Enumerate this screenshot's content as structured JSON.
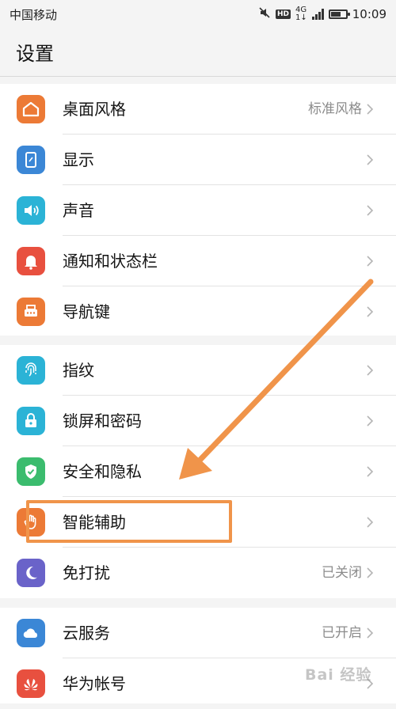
{
  "status_bar": {
    "carrier": "中国移动",
    "network_top": "4G",
    "network_bottom": "1↓",
    "hd": "HD",
    "time": "10:09"
  },
  "header": {
    "title": "设置"
  },
  "groups": [
    {
      "items": [
        {
          "label": "桌面风格",
          "value": "标准风格",
          "icon": "home-icon",
          "color": "#ec7a36"
        },
        {
          "label": "显示",
          "value": "",
          "icon": "display-icon",
          "color": "#3b87d6"
        },
        {
          "label": "声音",
          "value": "",
          "icon": "speaker-icon",
          "color": "#2bb3d6"
        },
        {
          "label": "通知和状态栏",
          "value": "",
          "icon": "bell-icon",
          "color": "#e8503f"
        },
        {
          "label": "导航键",
          "value": "",
          "icon": "navigation-keys-icon",
          "color": "#ec7a36"
        }
      ]
    },
    {
      "items": [
        {
          "label": "指纹",
          "value": "",
          "icon": "fingerprint-icon",
          "color": "#2bb3d6"
        },
        {
          "label": "锁屏和密码",
          "value": "",
          "icon": "lock-icon",
          "color": "#2bb3d6"
        },
        {
          "label": "安全和隐私",
          "value": "",
          "icon": "shield-icon",
          "color": "#3bbc6e"
        },
        {
          "label": "智能辅助",
          "value": "",
          "icon": "hand-icon",
          "color": "#ec7a36"
        },
        {
          "label": "免打扰",
          "value": "已关闭",
          "icon": "moon-icon",
          "color": "#6a63c9"
        }
      ]
    },
    {
      "items": [
        {
          "label": "云服务",
          "value": "已开启",
          "icon": "cloud-icon",
          "color": "#3b87d6"
        },
        {
          "label": "华为帐号",
          "value": "",
          "icon": "huawei-icon",
          "color": "#e8503f"
        }
      ]
    }
  ],
  "watermark": "Bai 经验",
  "colors": {
    "annotation": "#f0944a"
  }
}
